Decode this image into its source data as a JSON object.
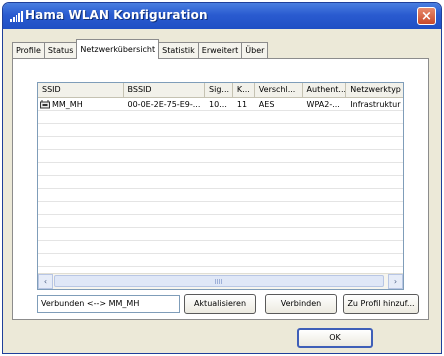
{
  "window": {
    "title": "Hama WLAN Konfiguration",
    "close_glyph": "×"
  },
  "tabs": [
    {
      "label": "Profile",
      "active": false
    },
    {
      "label": "Status",
      "active": false
    },
    {
      "label": "Netzwerkübersicht",
      "active": true
    },
    {
      "label": "Statistik",
      "active": false
    },
    {
      "label": "Erweitert",
      "active": false
    },
    {
      "label": "Über",
      "active": false
    }
  ],
  "network_list": {
    "columns": [
      "SSID",
      "BSSID",
      "Sig...",
      "K...",
      "Verschl...",
      "Authent...",
      "Netzwerktyp"
    ],
    "rows": [
      {
        "ssid": "MM_MH",
        "bssid": "00-0E-2E-75-E9-...",
        "signal": "10...",
        "channel": "11",
        "encryption": "AES",
        "authentication": "WPA2-...",
        "network_type": "Infrastruktur",
        "icon": "wireless-network-icon"
      }
    ]
  },
  "scrollbar": {
    "left_arrow": "‹",
    "right_arrow": "›"
  },
  "status": {
    "text": "Verbunden <--> MM_MH"
  },
  "buttons": {
    "refresh": "Aktualisieren",
    "connect": "Verbinden",
    "add_profile": "Zu Profil hinzuf...",
    "ok": "OK"
  },
  "colors": {
    "titlebar": "#2a5bd0",
    "dialog_bg": "#ece9d8",
    "close_button": "#c8492b"
  }
}
